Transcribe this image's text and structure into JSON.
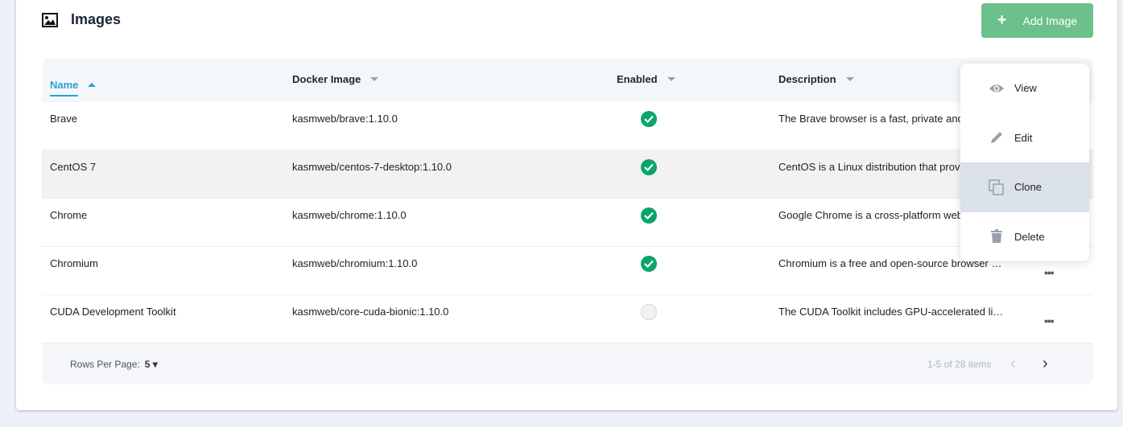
{
  "header": {
    "title": "Images",
    "icon": "image-icon",
    "add_button": "Add Image"
  },
  "columns": [
    {
      "label": "Name",
      "sort": "asc",
      "active": true
    },
    {
      "label": "Docker Image",
      "sort": "desc"
    },
    {
      "label": "Enabled",
      "sort": "desc"
    },
    {
      "label": "Description",
      "sort": "desc"
    }
  ],
  "rows": [
    {
      "name": "Brave",
      "image": "kasmweb/brave:1.10.0",
      "enabled": true,
      "description": "The Brave browser is a fast, private and secure web browser"
    },
    {
      "name": "CentOS 7",
      "image": "kasmweb/centos-7-desktop:1.10.0",
      "enabled": true,
      "description": "CentOS is a Linux distribution that provides a free platform"
    },
    {
      "name": "Chrome",
      "image": "kasmweb/chrome:1.10.0",
      "enabled": true,
      "description": "Google Chrome is a cross-platform web browser"
    },
    {
      "name": "Chromium",
      "image": "kasmweb/chromium:1.10.0",
      "enabled": true,
      "description": "Chromium is a free and open-source browser project"
    },
    {
      "name": "CUDA Development Toolkit",
      "image": "kasmweb/core-cuda-bionic:1.10.0",
      "enabled": false,
      "description": "The CUDA Toolkit includes GPU-accelerated libraries"
    }
  ],
  "menu": {
    "items": [
      {
        "label": "View",
        "icon": "eye-icon"
      },
      {
        "label": "Edit",
        "icon": "pencil-icon"
      },
      {
        "label": "Clone",
        "icon": "clone-icon",
        "highlighted": true
      },
      {
        "label": "Delete",
        "icon": "trash-icon"
      }
    ]
  },
  "footer": {
    "rows_per_page_label": "Rows Per Page:",
    "rows_per_page": "5",
    "page_info": "1-5 of 28 items"
  },
  "colors": {
    "accent": "#2a9fd8",
    "add_button": "#6cc08b",
    "enabled": "#0aa56c"
  }
}
